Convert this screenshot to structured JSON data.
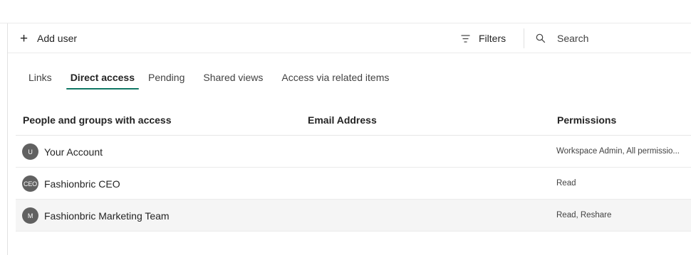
{
  "toolbar": {
    "add_user_label": "Add user",
    "filters_label": "Filters",
    "search_placeholder": "Search"
  },
  "tabs": [
    {
      "label": "Links",
      "active": false
    },
    {
      "label": "Direct access",
      "active": true
    },
    {
      "label": "Pending",
      "active": false
    },
    {
      "label": "Shared views",
      "active": false
    },
    {
      "label": "Access via related items",
      "active": false
    }
  ],
  "table": {
    "columns": {
      "name": "People and groups with access",
      "email": "Email Address",
      "permissions": "Permissions"
    },
    "rows": [
      {
        "avatar": "U",
        "name": "Your Account",
        "email": "",
        "permissions": "Workspace Admin, All permissio..."
      },
      {
        "avatar": "CEO",
        "name": "Fashionbric CEO",
        "email": "",
        "permissions": "Read"
      },
      {
        "avatar": "M",
        "name": "Fashionbric Marketing Team",
        "email": "",
        "permissions": "Read, Reshare"
      }
    ]
  },
  "colors": {
    "accent": "#117865",
    "avatar_bg": "#616161",
    "row_hover_bg": "#f5f5f5"
  },
  "icons": {
    "add": "plus-icon",
    "filters": "filter-icon",
    "search": "search-icon"
  }
}
